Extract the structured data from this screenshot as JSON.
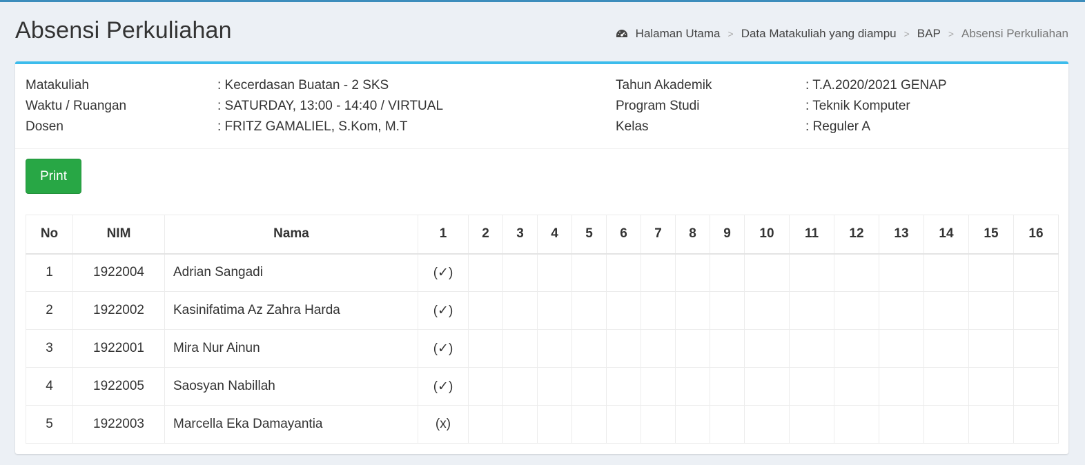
{
  "header": {
    "title": "Absensi Perkuliahan",
    "breadcrumb": [
      "Halaman Utama",
      "Data Matakuliah yang diampu",
      "BAP",
      "Absensi Perkuliahan"
    ]
  },
  "info": {
    "left": [
      {
        "label": "Matakuliah",
        "value": ": Kecerdasan Buatan - 2 SKS"
      },
      {
        "label": "Waktu / Ruangan",
        "value": ": SATURDAY, 13:00 - 14:40 / VIRTUAL"
      },
      {
        "label": "Dosen",
        "value": ": FRITZ GAMALIEL, S.Kom, M.T"
      }
    ],
    "right": [
      {
        "label": "Tahun Akademik",
        "value": ": T.A.2020/2021 GENAP"
      },
      {
        "label": "Program Studi",
        "value": ": Teknik Komputer"
      },
      {
        "label": "Kelas",
        "value": ": Reguler A"
      }
    ]
  },
  "print_label": "Print",
  "table": {
    "headers": [
      "No",
      "NIM",
      "Nama",
      "1",
      "2",
      "3",
      "4",
      "5",
      "6",
      "7",
      "8",
      "9",
      "10",
      "11",
      "12",
      "13",
      "14",
      "15",
      "16"
    ],
    "rows": [
      {
        "no": "1",
        "nim": "1922004",
        "nama": "Adrian Sangadi",
        "m1": "(✓)"
      },
      {
        "no": "2",
        "nim": "1922002",
        "nama": "Kasinifatima Az Zahra Harda",
        "m1": "(✓)"
      },
      {
        "no": "3",
        "nim": "1922001",
        "nama": "Mira Nur Ainun",
        "m1": "(✓)"
      },
      {
        "no": "4",
        "nim": "1922005",
        "nama": "Saosyan Nabillah",
        "m1": "(✓)"
      },
      {
        "no": "5",
        "nim": "1922003",
        "nama": "Marcella Eka Damayantia",
        "m1": "(x)"
      }
    ]
  }
}
